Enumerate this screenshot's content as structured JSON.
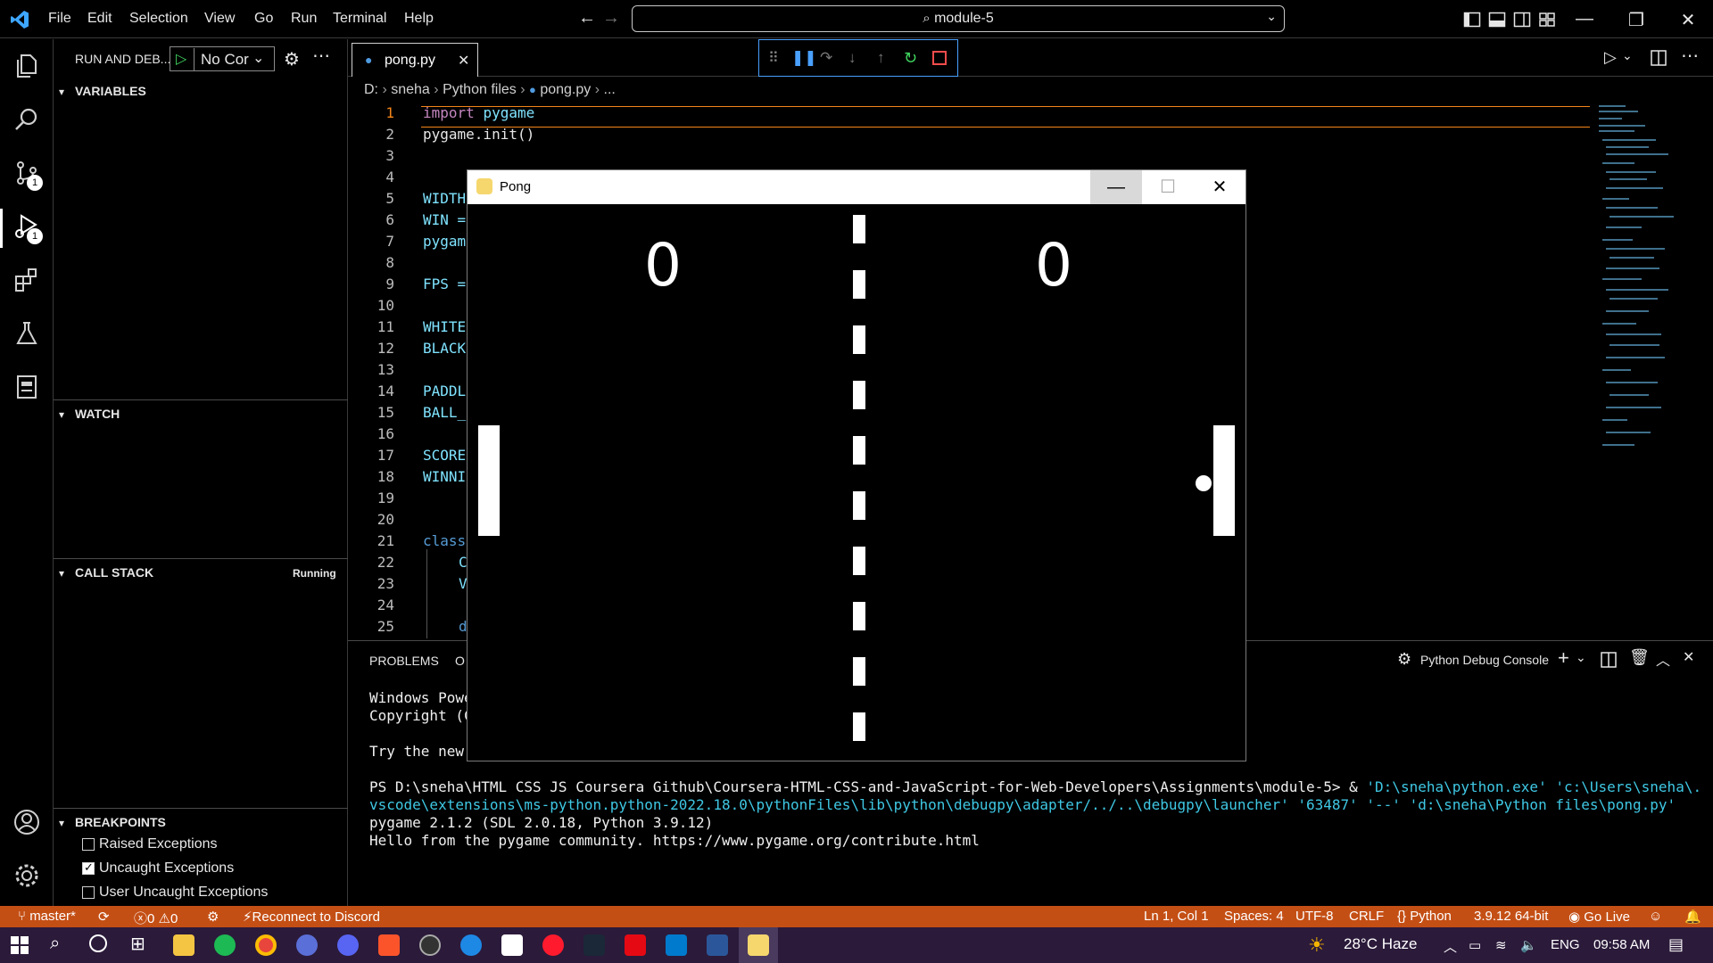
{
  "titlebar": {
    "menus": [
      "File",
      "Edit",
      "Selection",
      "View",
      "Go",
      "Run",
      "Terminal",
      "Help"
    ],
    "command_center": "module-5"
  },
  "sidebar": {
    "title": "RUN AND DEB...",
    "config": "No Cor",
    "sections": {
      "variables": "VARIABLES",
      "watch": "WATCH",
      "call_stack": "CALL STACK",
      "call_stack_status": "Running",
      "breakpoints": "BREAKPOINTS"
    },
    "breakpoints": [
      {
        "label": "Raised Exceptions",
        "checked": false
      },
      {
        "label": "Uncaught Exceptions",
        "checked": true
      },
      {
        "label": "User Uncaught Exceptions",
        "checked": false
      }
    ],
    "badges": {
      "source_control": "1",
      "debug": "1"
    }
  },
  "editor": {
    "tab": "pong.py",
    "breadcrumb": [
      "D:",
      "sneha",
      "Python files",
      "pong.py",
      "..."
    ],
    "line_numbers": [
      "1",
      "2",
      "3",
      "4",
      "5",
      "6",
      "7",
      "8",
      "9",
      "10",
      "11",
      "12",
      "13",
      "14",
      "15",
      "16",
      "17",
      "18",
      "19",
      "20",
      "21",
      "22",
      "23",
      "24",
      "25"
    ],
    "lines": {
      "l1": "import pygame",
      "l2": "pygame.init()",
      "l5": "WIDTH",
      "l6": "WIN =",
      "l7": "pygam",
      "l9": "FPS =",
      "l11": "WHITE",
      "l12": "BLACK",
      "l14": "PADDL",
      "l15": "BALL_",
      "l17": "SCORE",
      "l18": "WINNI",
      "l21": "class",
      "l22": "C",
      "l23": "V",
      "l25": "d"
    }
  },
  "panel": {
    "tab_problems": "PROBLEMS",
    "tab_output_partial": "O",
    "console_name": "Python Debug Console",
    "terminal_lines": {
      "t1": "Windows Powe",
      "t2": "Copyright (C",
      "t3": "Try the new",
      "prompt": "PS D:\\sneha\\HTML CSS JS Coursera Github\\Coursera-HTML-CSS-and-JavaScript-for-Web-Developers\\Assignments\\module-5>  & ",
      "cmd1": "'D:\\sneha\\python.exe' 'c:\\Users\\sneha\\.vscode\\e",
      "cmd2": "xtensions\\ms-python.python-2022.18.0\\pythonFiles\\lib\\python\\debugpy\\adapter/../..\\debugpy\\launcher' '63487' '--' 'd:\\sneha\\Python files\\pong.py'",
      "t6": "pygame 2.1.2 (SDL 2.0.18, Python 3.9.12)",
      "t7": "Hello from the pygame community. https://www.pygame.org/contribute.html"
    }
  },
  "statusbar": {
    "branch": "master*",
    "errors": "0",
    "warnings": "0",
    "discord": "Reconnect to Discord",
    "position": "Ln 1, Col 1",
    "spaces": "Spaces: 4",
    "encoding": "UTF-8",
    "eol": "CRLF",
    "language": "Python",
    "interpreter": "3.9.12 64-bit",
    "golive": "Go Live"
  },
  "taskbar": {
    "weather": "28°C  Haze",
    "lang": "ENG",
    "time": "09:58 AM"
  },
  "pong": {
    "title": "Pong",
    "score_left": "0",
    "score_right": "0"
  },
  "colors": {
    "accent": "#c44f15",
    "debug_border": "#4aa0ff",
    "current_line": "#f38518",
    "keyword": "#c586c0",
    "code": "#7fe3ff"
  }
}
